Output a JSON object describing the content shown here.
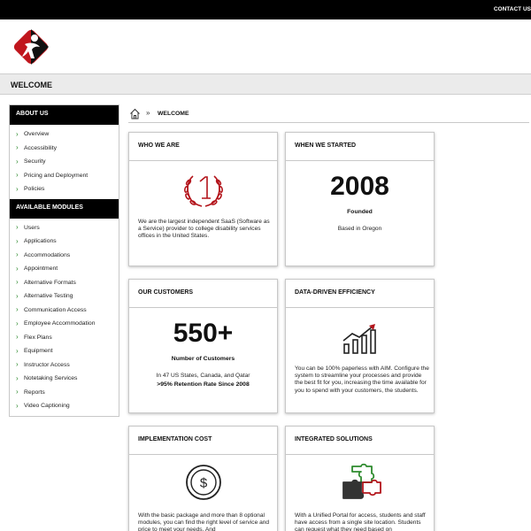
{
  "header": {
    "contact_label": "CONTACT US"
  },
  "logo": {
    "icon": "figure-logo-icon",
    "colors": {
      "primary": "#c0161d",
      "secondary": "#000000"
    }
  },
  "page": {
    "title": "WELCOME"
  },
  "sidebar": {
    "about_heading": "ABOUT US",
    "about_items": [
      "Overview",
      "Accessibility",
      "Security",
      "Pricing and Deployment",
      "Policies"
    ],
    "modules_heading": "AVAILABLE MODULES",
    "module_items": [
      "Users",
      "Applications",
      "Accommodations",
      "Appointment",
      "Alternative Formats",
      "Alternative Testing",
      "Communication Access",
      "Employee Accommodation",
      "Flex Plans",
      "Equipment",
      "Instructor Access",
      "Notetaking Services",
      "Reports",
      "Video Captioning"
    ],
    "chevron_color": "#2e8b2e"
  },
  "breadcrumb": {
    "home_icon": "home-icon",
    "separator": "»",
    "current": "WELCOME"
  },
  "cards": {
    "who": {
      "title": "WHO WE ARE",
      "icon": "number-one-laurel-icon",
      "text": "We are the largest independent SaaS (Software as a Service) provider to college disability services offices in the United States."
    },
    "started": {
      "title": "WHEN WE STARTED",
      "year": "2008",
      "label": "Founded",
      "location": "Based in Oregon"
    },
    "customers": {
      "title": "OUR CUSTOMERS",
      "count": "550+",
      "label": "Number of Customers",
      "line1": "In 47 US States, Canada, and Qatar",
      "line2": ">95% Retention Rate Since 2008"
    },
    "efficiency": {
      "title": "DATA-DRIVEN EFFICIENCY",
      "icon": "growth-chart-icon",
      "text": "You can be 100% paperless with AIM. Configure the system to streamline your processes and provide the best fit for you, increasing the time available for you to spend with your customers, the students."
    },
    "cost": {
      "title": "IMPLEMENTATION COST",
      "icon": "dollar-coin-icon",
      "text": "With the basic package and more than 8 optional modules, you can find the right level of service and price to meet your needs. And"
    },
    "solutions": {
      "title": "INTEGRATED SOLUTIONS",
      "icon": "puzzle-pieces-icon",
      "text": "With a Unified Portal for access, students and staff have access from a single site location. Students can request what they need based on"
    }
  },
  "colors": {
    "accent_red": "#b3141b",
    "black": "#000000",
    "light_gray": "#ebebeb"
  }
}
